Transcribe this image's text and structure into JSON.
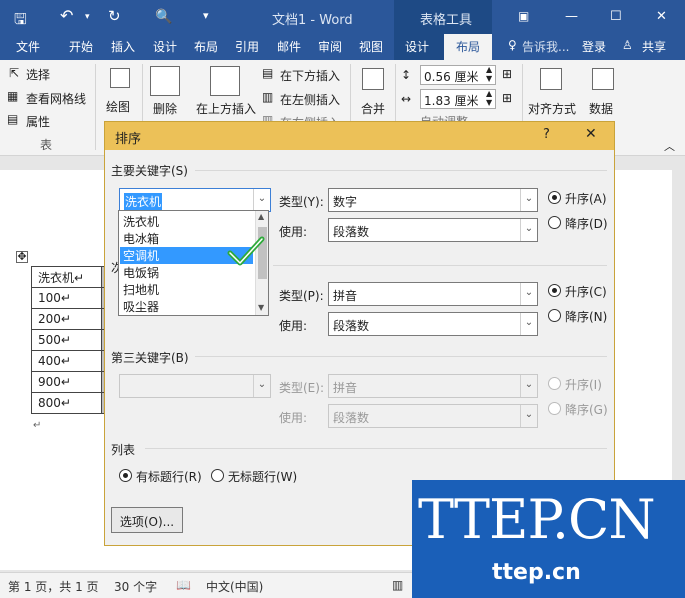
{
  "window": {
    "title": "文档1 - Word",
    "context_tab": "表格工具"
  },
  "tabs": [
    "文件",
    "开始",
    "插入",
    "设计",
    "布局",
    "引用",
    "邮件",
    "审阅",
    "视图",
    "设计",
    "布局"
  ],
  "tellme": "告诉我...",
  "login": "登录",
  "share": "共享",
  "ribbon": {
    "select": "选择",
    "gridlines": "查看网格线",
    "properties": "属性",
    "table_group": "表",
    "draw": "绘图",
    "delete": "删除",
    "insert_above": "在上方插入",
    "insert_below": "在下方插入",
    "insert_left": "在左侧插入",
    "insert_right": "在右侧插入",
    "merge": "合并",
    "height": "0.56 厘米",
    "width": "1.83 厘米",
    "autofit": "自动调整",
    "align": "对齐方式",
    "data": "数据"
  },
  "table": {
    "rows": [
      [
        "洗衣机↵",
        ""
      ],
      [
        "100↵",
        ""
      ],
      [
        "200↵",
        ""
      ],
      [
        "500↵",
        ""
      ],
      [
        "400↵",
        ""
      ],
      [
        "900↵",
        ""
      ],
      [
        "800↵",
        ""
      ]
    ]
  },
  "dialog": {
    "title": "排序",
    "help": "?",
    "close": "✕",
    "primary_key": "主要关键字(S)",
    "primary_value": "洗衣机",
    "type_label": "类型(Y):",
    "type_value": "数字",
    "use_label": "使用:",
    "use_value": "段落数",
    "asc_a": "升序(A)",
    "desc_d": "降序(D)",
    "secondary_type_label": "类型(P):",
    "secondary_type_value": "拼音",
    "secondary_use_label": "使用:",
    "secondary_use_value": "段落数",
    "asc_c": "升序(C)",
    "desc_n": "降序(N)",
    "third_key": "第三关键字(B)",
    "third_type_label": "类型(E):",
    "third_type_value": "拼音",
    "third_use_label": "使用:",
    "third_use_value": "段落数",
    "asc_i": "升序(I)",
    "desc_g": "降序(G)",
    "list_label": "列表",
    "has_header": "有标题行(R)",
    "no_header": "无标题行(W)",
    "options": "选项(O)...",
    "secondary_partial": "次"
  },
  "dropdown": [
    "洗衣机",
    "电冰箱",
    "空调机",
    "电饭锅",
    "扫地机",
    "吸尘器"
  ],
  "status": {
    "page": "第 1 页，共 1 页",
    "words": "30 个字",
    "lang": "中文(中国)"
  },
  "watermark": {
    "big": "TTEP.CN",
    "small": "ttep.cn"
  },
  "colors": {
    "ribbon_blue": "#2b579a",
    "title_yellow": "#ecc158",
    "select_blue": "#3399ff",
    "check_green": "#2eaa3a",
    "watermark_blue": "#1a5fb8"
  }
}
